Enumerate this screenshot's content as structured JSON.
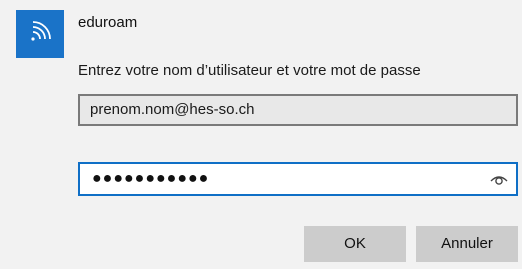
{
  "network": {
    "name": "eduroam",
    "icon": "wifi-icon",
    "tile_color": "#1a73c8"
  },
  "prompt": {
    "text": "Entrez votre nom d’utilisateur et votre mot de passe"
  },
  "username": {
    "value": "prenom.nom@hes-so.ch"
  },
  "password": {
    "masked_value": "●●●●●●●●●●●",
    "reveal_icon": "eye-icon"
  },
  "buttons": {
    "ok_label": "OK",
    "cancel_label": "Annuler"
  },
  "colors": {
    "background": "#f2f2f2",
    "accent": "#0f6fc6",
    "button": "#cccccc"
  }
}
